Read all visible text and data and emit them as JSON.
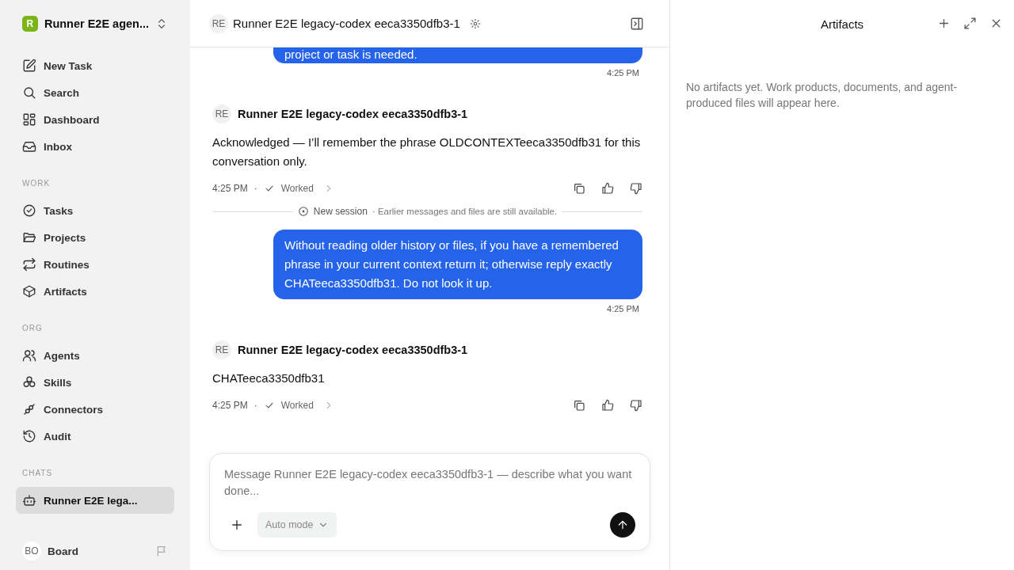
{
  "workspace": {
    "name": "Runner E2E agen...",
    "logo_letter": "R"
  },
  "sidebar": {
    "sections": [
      {
        "items": [
          {
            "label": "New Task",
            "selected": false
          },
          {
            "label": "Search",
            "selected": false
          },
          {
            "label": "Dashboard",
            "selected": false
          },
          {
            "label": "Inbox",
            "selected": false
          }
        ]
      },
      {
        "heading": "WORK",
        "items": [
          {
            "label": "Tasks",
            "selected": false
          },
          {
            "label": "Projects",
            "selected": false
          },
          {
            "label": "Routines",
            "selected": false
          },
          {
            "label": "Artifacts",
            "selected": false
          }
        ]
      },
      {
        "heading": "ORG",
        "items": [
          {
            "label": "Agents",
            "selected": false
          },
          {
            "label": "Skills",
            "selected": false
          },
          {
            "label": "Connectors",
            "selected": false
          },
          {
            "label": "Audit",
            "selected": false
          }
        ]
      },
      {
        "heading": "CHATS",
        "items": [
          {
            "label": "Runner E2E lega...",
            "selected": true
          }
        ]
      }
    ],
    "user": {
      "initials": "BO",
      "name": "Board"
    }
  },
  "chat": {
    "avatar": "RE",
    "title": "Runner E2E legacy-codex eeca3350dfb3-1",
    "messages": [
      {
        "kind": "user",
        "text": "project or task is needed.",
        "time": "4:25 PM"
      },
      {
        "kind": "agent",
        "avatar": "RE",
        "author": "Runner E2E legacy-codex eeca3350dfb3-1",
        "text": "Acknowledged — I’ll remember the phrase OLDCONTEXTeeca3350dfb31 for this conversation only.",
        "time": "4:25 PM",
        "separator": "·",
        "status": "Worked"
      },
      {
        "kind": "divider",
        "label": "New session",
        "note": "· Earlier messages and files are still available."
      },
      {
        "kind": "user",
        "text": "Without reading older history or files, if you have a remembered phrase in your current context return it; otherwise reply exactly CHATeeca3350dfb31. Do not look it up.",
        "time": "4:25 PM"
      },
      {
        "kind": "agent",
        "avatar": "RE",
        "author": "Runner E2E legacy-codex eeca3350dfb3-1",
        "text": "CHATeeca3350dfb31",
        "time": "4:25 PM",
        "separator": "·",
        "status": "Worked"
      }
    ],
    "composer": {
      "placeholder": "Message Runner E2E legacy-codex eeca3350dfb3-1 — describe what you want done...",
      "mode": "Auto mode"
    }
  },
  "artifacts": {
    "title": "Artifacts",
    "empty_text": "No artifacts yet. Work products, documents, and agent-produced files will appear here."
  }
}
